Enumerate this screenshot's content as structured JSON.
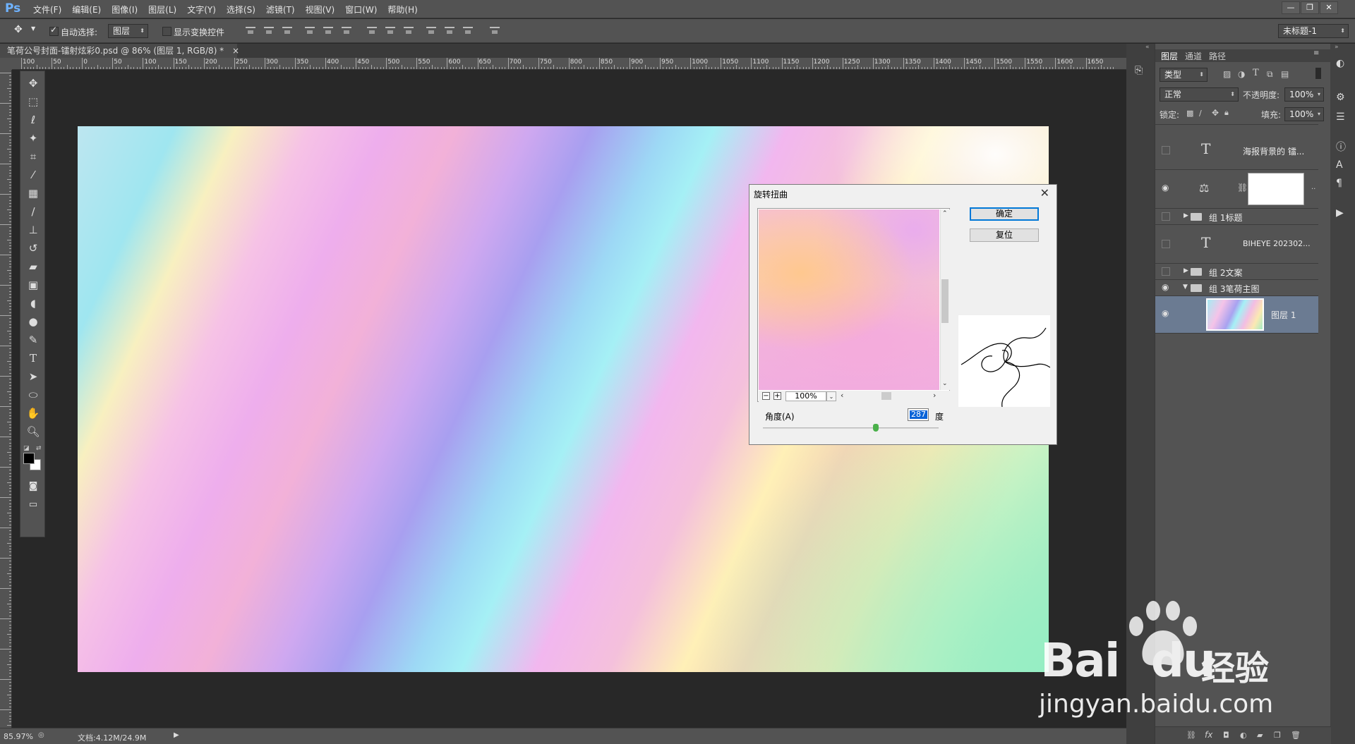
{
  "app": {
    "logo": "Ps"
  },
  "menu": [
    "文件(F)",
    "编辑(E)",
    "图像(I)",
    "图层(L)",
    "文字(Y)",
    "选择(S)",
    "滤镜(T)",
    "视图(V)",
    "窗口(W)",
    "帮助(H)"
  ],
  "window_controls": {
    "minimize": "—",
    "restore": "❐",
    "close": "✕"
  },
  "options": {
    "auto_select_label": "自动选择:",
    "auto_select_checked": true,
    "auto_select_target": "图层",
    "show_transform_label": "显示变换控件",
    "show_transform_checked": false,
    "workspace": "未标题-1"
  },
  "document": {
    "tab_title": "笔荷公号封面-镭射炫彩0.psd @ 86% (图层 1, RGB/8) *",
    "tab_close": "×"
  },
  "ruler": {
    "h_labels": [
      "100",
      "50",
      "0",
      "50",
      "100",
      "150",
      "200",
      "250",
      "300",
      "350",
      "400",
      "450",
      "500",
      "550",
      "600",
      "650",
      "700",
      "750",
      "800",
      "850",
      "900",
      "950",
      "1000",
      "1050",
      "1100",
      "1150",
      "1200",
      "1250",
      "1300",
      "1350",
      "1400",
      "1450",
      "1500",
      "1550",
      "1600",
      "1650"
    ]
  },
  "dialog": {
    "title": "旋转扭曲",
    "close": "✕",
    "ok_label": "确定",
    "reset_label": "复位",
    "zoom_value": "100%",
    "zoom_out": "−",
    "zoom_in": "+",
    "angle_label": "角度(A)",
    "angle_value": "287",
    "angle_unit": "度",
    "angle_min": -999,
    "angle_max": 999
  },
  "layers_panel": {
    "tabs": [
      "图层",
      "通道",
      "路径"
    ],
    "filter_label": "类型",
    "blend_mode": "正常",
    "opacity_label": "不透明度:",
    "opacity_value": "100%",
    "lock_label": "锁定:",
    "fill_label": "填充:",
    "fill_value": "100%",
    "layers": [
      {
        "type": "text",
        "name": "海报背景的 镭...",
        "visible": false
      },
      {
        "type": "adjustment",
        "name": "",
        "visible": true
      },
      {
        "type": "group",
        "name": "组 1标题",
        "visible": false,
        "expanded": false
      },
      {
        "type": "text",
        "name": "BIHEYE 202302...",
        "visible": false
      },
      {
        "type": "group",
        "name": "组 2文案",
        "visible": false,
        "expanded": false
      },
      {
        "type": "group",
        "name": "组 3笔荷主图",
        "visible": true,
        "expanded": true
      },
      {
        "type": "pixel",
        "name": "图层 1",
        "visible": true,
        "selected": true
      }
    ]
  },
  "status": {
    "zoom": "85.97%",
    "doc_info": "文档:4.12M/24.9M"
  },
  "watermark": {
    "brand": "Bai",
    "brand2": "du",
    "suffix": "经验",
    "url": "jingyan.baidu.com"
  }
}
